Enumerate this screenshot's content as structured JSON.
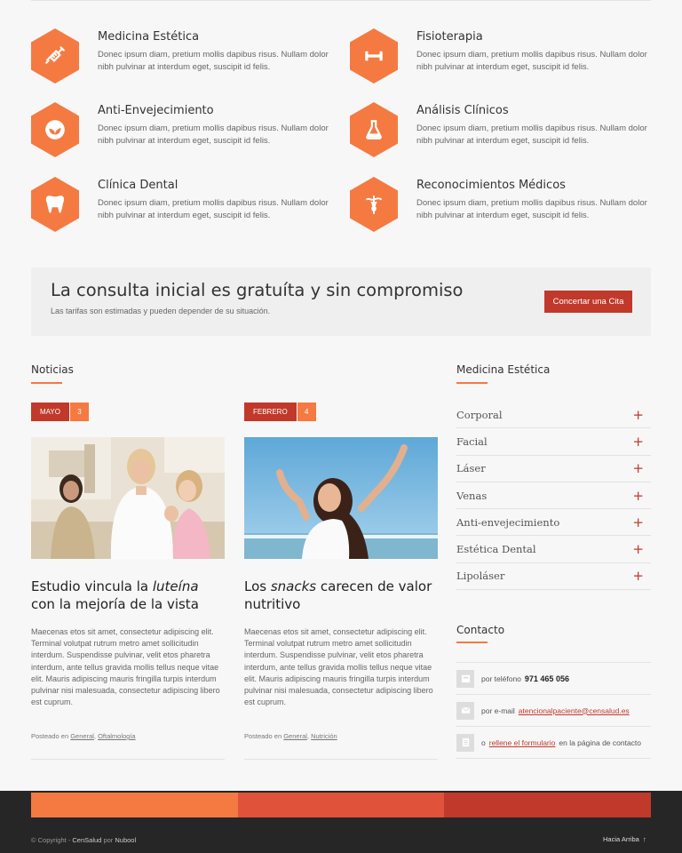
{
  "services": [
    {
      "title": "Medicina Estética",
      "text": "Donec ipsum diam, pretium mollis dapibus risus. Nullam dolor nibh pulvinar at interdum eget, suscipit id felis.",
      "icon": "syringe-icon"
    },
    {
      "title": "Fisioterapia",
      "text": "Donec ipsum diam, pretium mollis dapibus risus. Nullam dolor nibh pulvinar at interdum eget, suscipit id felis.",
      "icon": "dumbbell-icon"
    },
    {
      "title": "Anti-Envejecimiento",
      "text": "Donec ipsum diam, pretium mollis dapibus risus. Nullam dolor nibh pulvinar at interdum eget, suscipit id felis.",
      "icon": "leaves-icon"
    },
    {
      "title": "Análisis Clínicos",
      "text": "Donec ipsum diam, pretium mollis dapibus risus. Nullam dolor nibh pulvinar at interdum eget, suscipit id felis.",
      "icon": "flask-icon"
    },
    {
      "title": "Clínica Dental",
      "text": "Donec ipsum diam, pretium mollis dapibus risus. Nullam dolor nibh pulvinar at interdum eget, suscipit id felis.",
      "icon": "tooth-icon"
    },
    {
      "title": "Reconocimientos Médicos",
      "text": "Donec ipsum diam, pretium mollis dapibus risus. Nullam dolor nibh pulvinar at interdum eget, suscipit id felis.",
      "icon": "caduceus-icon"
    }
  ],
  "cta": {
    "title": "La consulta inicial es gratuíta y sin compromiso",
    "subtitle": "Las tarifas son estimadas y pueden depender de su situación.",
    "button": "Concertar una Cita"
  },
  "news": {
    "heading": "Noticias",
    "posts": [
      {
        "month": "MAYO",
        "day": "3",
        "title_pre": "Estudio vincula la ",
        "title_em": "luteína",
        "title_post": " con la mejoría de la vista",
        "text": "Maecenas etos sit amet, consectetur adipiscing elit. Terminal volutpat rutrum metro amet sollicitudin interdum. Suspendisse pulvinar, velit etos pharetra interdum, ante tellus gravida mollis tellus neque vitae elit. Mauris adipiscing mauris fringilla turpis interdum pulvinar nisi malesuada, consectetur adipiscing libero est cuprum.",
        "meta_prefix": "Posteado en",
        "cat1": "General",
        "cat2": "Oftalmología",
        "image": "doctor-child-photo"
      },
      {
        "month": "FEBRERO",
        "day": "4",
        "title_pre": "Los ",
        "title_em": "snacks",
        "title_post": " carecen de valor nutritivo",
        "text": "Maecenas etos sit amet, consectetur adipiscing elit. Terminal volutpat rutrum metro amet sollicitudin interdum. Suspendisse pulvinar, velit etos pharetra interdum, ante tellus gravida mollis tellus neque vitae elit. Mauris adipiscing mauris fringilla turpis interdum pulvinar nisi malesuada, consectetur adipiscing libero est cuprum.",
        "meta_prefix": "Posteado en",
        "cat1": "General",
        "cat2": "Nutrición",
        "image": "woman-beach-photo"
      }
    ]
  },
  "sidebar": {
    "heading": "Medicina Estética",
    "items": [
      "Corporal",
      "Facial",
      "Láser",
      "Venas",
      "Anti-envejecimiento",
      "Estética Dental",
      "Lipoláser"
    ],
    "contact_heading": "Contacto",
    "phone_label": "por teléfono",
    "phone": "971 465 056",
    "email_label": "por e-mail",
    "email": "atencionalpaciente@censalud.es",
    "form_pre": "o",
    "form_link": "rellene el formulario",
    "form_post": "en la página de contacto"
  },
  "footer": {
    "copyright_pre": "© Copyright -",
    "brand": "CenSalud",
    "by": "por",
    "author": "Nubool",
    "to_top": "Hacia Arriba",
    "to_top_icon": "↑",
    "colors": [
      "#f47a42",
      "#e0523a",
      "#c0392b"
    ]
  },
  "colors": {
    "accent": "#f47a42",
    "red": "#c0392b"
  }
}
